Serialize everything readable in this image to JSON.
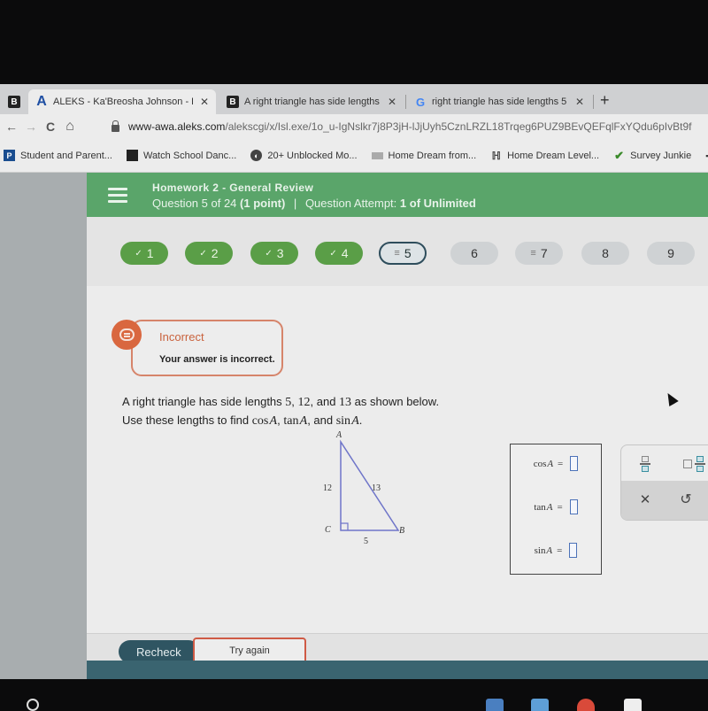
{
  "browser": {
    "tabs": [
      {
        "favicon": "aleks-icon",
        "favicon_glyph": "A",
        "title": "ALEKS - Ka'Breosha Johnson - H",
        "active": true
      },
      {
        "favicon": "brainly-icon",
        "favicon_glyph": "B",
        "title": "A right triangle has side lengths",
        "active": false
      },
      {
        "favicon": "google-icon",
        "favicon_glyph": "G",
        "title": "right triangle has side lengths 5",
        "active": false
      }
    ],
    "pinned_tab_glyph": "B",
    "close_glyph": "✕",
    "new_tab_glyph": "+",
    "nav": {
      "back": "←",
      "forward": "→",
      "reload": "C",
      "home": "⌂"
    },
    "url_host": "www-awa.aleks.com",
    "url_path": "/alekscgi/x/Isl.exe/1o_u-IgNslkr7j8P3jH-lJjUyh5CznLRZL18Trqeg6PUZ9BEvQEFqlFxYQdu6pIvBt9f",
    "bookmarks": [
      {
        "icon": "p-icon",
        "glyph": "P",
        "label": "Student and Parent..."
      },
      {
        "icon": "square-icon",
        "glyph": "",
        "label": "Watch School Danc..."
      },
      {
        "icon": "globe-icon",
        "glyph": "◐",
        "label": "20+ Unblocked Mo..."
      },
      {
        "icon": "image-icon",
        "glyph": "",
        "label": "Home Dream from..."
      },
      {
        "icon": "home-dream-icon",
        "glyph": "ℍ",
        "label": "Home Dream Level..."
      },
      {
        "icon": "check-icon",
        "glyph": "✔",
        "label": "Survey Junkie"
      }
    ],
    "bookmarks_overflow": "▪▪"
  },
  "header": {
    "title": "Homework 2 - General Review",
    "question": "Question 5 of 24",
    "points": "(1 point)",
    "separator": "|",
    "attempt_label": "Question Attempt:",
    "attempt_value": "1 of Unlimited",
    "accent": "#5aa56a"
  },
  "question_nav": [
    {
      "number": "1",
      "status": "done",
      "icon": "✓"
    },
    {
      "number": "2",
      "status": "done",
      "icon": "✓"
    },
    {
      "number": "3",
      "status": "done",
      "icon": "✓"
    },
    {
      "number": "4",
      "status": "done",
      "icon": "✓"
    },
    {
      "number": "5",
      "status": "current",
      "icon": "≡"
    },
    {
      "number": "6",
      "status": "todo",
      "icon": ""
    },
    {
      "number": "7",
      "status": "partial",
      "icon": "≡"
    },
    {
      "number": "8",
      "status": "todo",
      "icon": ""
    },
    {
      "number": "9",
      "status": "todo",
      "icon": ""
    }
  ],
  "feedback": {
    "title": "Incorrect",
    "message": "Your answer is incorrect.",
    "color": "#d9673f"
  },
  "prompt": {
    "line1_pre": "A right triangle has side lengths ",
    "a": "5",
    "sep1": ", ",
    "b": "12",
    "sep2": ", and ",
    "c": "13",
    "line1_post": " as shown below.",
    "line2_pre": "Use these lengths to find ",
    "cos": "cos",
    "tan": "tan",
    "sin": "sin",
    "var": "A",
    "comma1": ", ",
    "comma2": ", and ",
    "end": "."
  },
  "triangle": {
    "vertex_a": "A",
    "vertex_b": "B",
    "vertex_c": "C",
    "side_ac": "12",
    "side_ab": "13",
    "side_cb": "5"
  },
  "answers": [
    {
      "func": "cos",
      "var": "A",
      "equals": "=",
      "value": ""
    },
    {
      "func": "tan",
      "var": "A",
      "equals": "=",
      "value": ""
    },
    {
      "func": "sin",
      "var": "A",
      "equals": "=",
      "value": ""
    }
  ],
  "keypad": {
    "clear_glyph": "✕",
    "undo_glyph": "↺"
  },
  "footer": {
    "recheck_label": "Recheck",
    "try_again_label": "Try again"
  }
}
